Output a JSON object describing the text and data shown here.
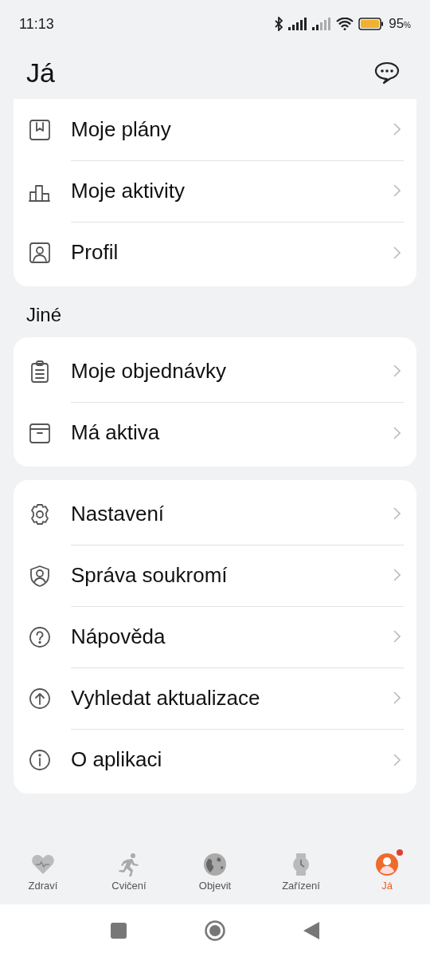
{
  "status_bar": {
    "time": "11:13",
    "battery": "95",
    "battery_unit": "%"
  },
  "header": {
    "title": "Já"
  },
  "sections": [
    {
      "items": [
        {
          "label": "Moje plány"
        },
        {
          "label": "Moje aktivity"
        },
        {
          "label": "Profil"
        }
      ]
    },
    {
      "title": "Jiné",
      "items": [
        {
          "label": "Moje objednávky"
        },
        {
          "label": "Má aktiva"
        }
      ]
    },
    {
      "items": [
        {
          "label": "Nastavení"
        },
        {
          "label": "Správa soukromí"
        },
        {
          "label": "Nápověda"
        },
        {
          "label": "Vyhledat aktualizace"
        },
        {
          "label": "O aplikaci"
        }
      ]
    }
  ],
  "tabs": [
    {
      "label": "Zdraví",
      "selected": false,
      "dot": false
    },
    {
      "label": "Cvičení",
      "selected": false,
      "dot": false
    },
    {
      "label": "Objevit",
      "selected": false,
      "dot": false
    },
    {
      "label": "Zařízení",
      "selected": false,
      "dot": false
    },
    {
      "label": "Já",
      "selected": true,
      "dot": true
    }
  ]
}
